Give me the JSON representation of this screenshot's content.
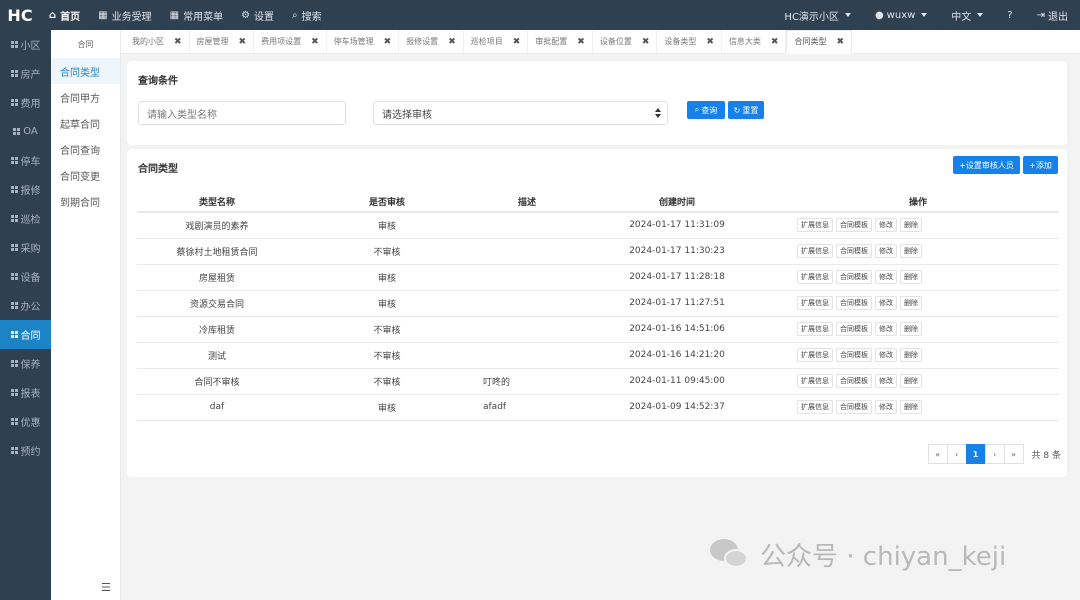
{
  "topbar": {
    "logo": "HC",
    "nav": [
      {
        "label": "首页",
        "icon": "home-icon",
        "active": true
      },
      {
        "label": "业务受理",
        "icon": "table-icon"
      },
      {
        "label": "常用菜单",
        "icon": "table-icon"
      },
      {
        "label": "设置",
        "icon": "gear-icon"
      },
      {
        "label": "搜索",
        "icon": "search-icon"
      }
    ],
    "community": "HC演示小区",
    "user": "wuxw",
    "language": "中文",
    "logout": "退出"
  },
  "sidebar": {
    "items": [
      "小区",
      "房产",
      "费用",
      "OA",
      "停车",
      "报修",
      "巡检",
      "采购",
      "设备",
      "办公",
      "合同",
      "保养",
      "报表",
      "优惠",
      "预约"
    ],
    "active_index": 10
  },
  "submenu": {
    "header": "合同",
    "items": [
      "合同类型",
      "合同甲方",
      "起草合同",
      "合同查询",
      "合同变更",
      "到期合同"
    ],
    "active_index": 0
  },
  "tabs": [
    "我的小区",
    "房屋管理",
    "费用项设置",
    "停车场管理",
    "报修设置",
    "巡检项目",
    "审批配置",
    "设备位置",
    "设备类型",
    "信息大类",
    "合同类型"
  ],
  "query": {
    "title": "查询条件",
    "name_placeholder": "请输入类型名称",
    "audit_placeholder": "请选择审核",
    "search_label": "查询",
    "reset_label": "重置"
  },
  "list": {
    "title": "合同类型",
    "set_auditor_label": "+设置审核人员",
    "add_label": "+添加",
    "columns": [
      "类型名称",
      "是否审核",
      "描述",
      "创建时间",
      "操作"
    ],
    "action_labels": [
      "扩展信息",
      "合同模板",
      "修改",
      "删除"
    ],
    "rows": [
      {
        "name": "戏剧演员的素养",
        "audit": "审核",
        "desc": "",
        "time": "2024-01-17 11:31:09"
      },
      {
        "name": "蔡徐村土地租赁合同",
        "audit": "不审核",
        "desc": "",
        "time": "2024-01-17 11:30:23"
      },
      {
        "name": "房屋租赁",
        "audit": "审核",
        "desc": "",
        "time": "2024-01-17 11:28:18"
      },
      {
        "name": "资源交易合同",
        "audit": "审核",
        "desc": "",
        "time": "2024-01-17 11:27:51"
      },
      {
        "name": "冷库租赁",
        "audit": "不审核",
        "desc": "",
        "time": "2024-01-16 14:51:06"
      },
      {
        "name": "测试",
        "audit": "不审核",
        "desc": "",
        "time": "2024-01-16 14:21:20"
      },
      {
        "name": "合同不审核",
        "audit": "不审核",
        "desc": "叮咚的",
        "time": "2024-01-11 09:45:00"
      },
      {
        "name": "daf",
        "audit": "审核",
        "desc": "afadf",
        "time": "2024-01-09 14:52:37"
      }
    ]
  },
  "pagination": {
    "first": "«",
    "prev": "‹",
    "current": "1",
    "next": "›",
    "last": "»",
    "total": "共 8 条"
  },
  "watermark": "公众号 · chiyan_keji",
  "colors": {
    "sidebar": "#2f4050",
    "accent": "#1681e8"
  }
}
